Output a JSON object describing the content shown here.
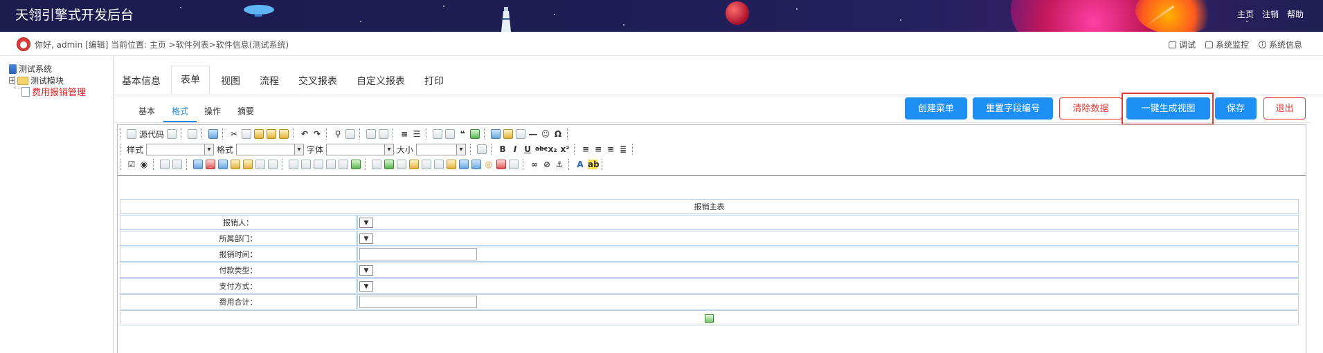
{
  "header": {
    "title": "天翎引擎式开发后台",
    "links": [
      "主页",
      "注销",
      "帮助"
    ]
  },
  "subheader": {
    "greeting": "你好, admin [编辑]",
    "location": "当前位置: 主页 >软件列表>软件信息(测试系统)",
    "sys_links": [
      "调试",
      "系统监控",
      "系统信息"
    ]
  },
  "tree": {
    "root": "测试系统",
    "module": "测试模块",
    "active_item": "费用报销管理"
  },
  "main_tabs": [
    "基本信息",
    "表单",
    "视图",
    "流程",
    "交叉报表",
    "自定义报表",
    "打印"
  ],
  "main_tab_active": "表单",
  "sub_tabs": [
    "基本",
    "格式",
    "操作",
    "摘要"
  ],
  "sub_tab_active": "格式",
  "buttons": {
    "create_menu": "创建菜单",
    "reset_field": "重置字段编号",
    "clear_data": "清除数据",
    "gen_view": "一键生成视图",
    "save": "保存",
    "exit": "退出"
  },
  "toolbar": {
    "source": "源代码",
    "style_label": "样式",
    "format_label": "格式",
    "font_label": "字体",
    "size_label": "大小"
  },
  "form": {
    "title": "报销主表",
    "rows": [
      {
        "label": "报销人：",
        "control": "select"
      },
      {
        "label": "所属部门：",
        "control": "select"
      },
      {
        "label": "报销时间：",
        "control": "input"
      },
      {
        "label": "付款类型：",
        "control": "select"
      },
      {
        "label": "支付方式：",
        "control": "select"
      },
      {
        "label": "费用合计：",
        "control": "input"
      }
    ]
  },
  "colors": {
    "header_bg": "#1e1d55",
    "primary": "#1e90f5",
    "danger": "#e53935",
    "tree_active": "#e02020"
  }
}
